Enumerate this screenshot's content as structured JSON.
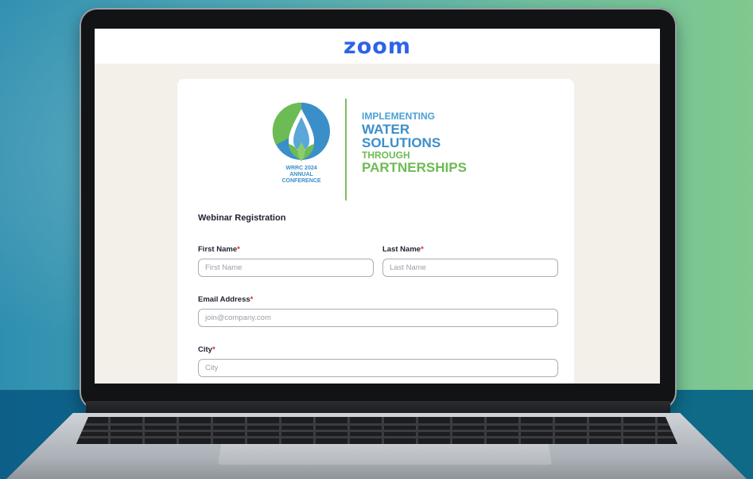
{
  "header": {
    "logo_text": "zoom"
  },
  "banner": {
    "emblem_lines": [
      "WRRC 2024",
      "ANNUAL",
      "CONFERENCE"
    ],
    "tagline": [
      "IMPLEMENTING",
      "WATER",
      "SOLUTIONS",
      "THROUGH",
      "PARTNERSHIPS"
    ]
  },
  "form": {
    "title": "Webinar Registration",
    "required_marker": "*",
    "first_name": {
      "label": "First Name",
      "placeholder": "First Name",
      "value": ""
    },
    "last_name": {
      "label": "Last Name",
      "placeholder": "Last Name",
      "value": ""
    },
    "email": {
      "label": "Email Address",
      "placeholder": "join@company.com",
      "value": ""
    },
    "city": {
      "label": "City",
      "placeholder": "City",
      "value": ""
    }
  },
  "colors": {
    "zoom_blue": "#2d63e8",
    "water_blue": "#3b8fc9",
    "leaf_green": "#6dbb55",
    "required_red": "#e02828"
  }
}
